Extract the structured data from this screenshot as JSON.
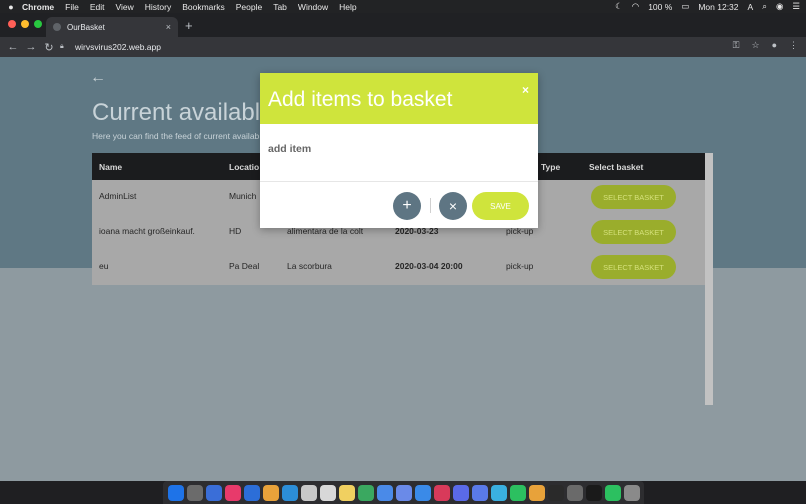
{
  "menubar": {
    "apple": "",
    "items": [
      "Chrome",
      "File",
      "Edit",
      "View",
      "History",
      "Bookmarks",
      "People",
      "Tab",
      "Window",
      "Help"
    ],
    "battery": "100 %",
    "clock": "Mon 12:32"
  },
  "browser": {
    "tab_title": "OurBasket",
    "tab_close": "×",
    "new_tab": "+",
    "url": "wirvsvirus202.web.app",
    "traffic_colors": [
      "#ff5f57",
      "#febc2e",
      "#28c840"
    ]
  },
  "page": {
    "back": "←",
    "title": "Current available b",
    "subtitle": "Here you can find the feed of current availab",
    "table": {
      "headers": {
        "name": "Name",
        "location": "Locatio",
        "type": "Type",
        "select": "Select basket"
      },
      "rows": [
        {
          "name": "AdminList",
          "location": "Munich",
          "place": "",
          "date": "",
          "type": "",
          "button": "SELECT BASKET"
        },
        {
          "name": "ioana macht großeinkauf.",
          "location": "HD",
          "place": "alimentara de la colt",
          "date": "2020-03-23",
          "type": "pick-up",
          "button": "SELECT BASKET"
        },
        {
          "name": "eu",
          "location": "Pa Deal",
          "place": "La scorbura",
          "date": "2020-03-04 20:00",
          "type": "pick-up",
          "button": "SELECT BASKET"
        }
      ]
    }
  },
  "modal": {
    "title": "Add items to basket",
    "close": "×",
    "field_label": "add item",
    "add_button": "+",
    "cancel_button": "×",
    "save_button": "SAVE",
    "accent": "#cfe43c"
  },
  "dock": {
    "icon_colors": [
      "#1e73e8",
      "#6b6b6b",
      "#3a6ed8",
      "#e83a6b",
      "#2c6ed8",
      "#e8a23a",
      "#2c8ed8",
      "#c8c8c8",
      "#d8d8d8",
      "#f0d060",
      "#3aa860",
      "#4a8ae8",
      "#6a8ae8",
      "#3a8ae8",
      "#d83a5a",
      "#5a6ae8",
      "#5a7ae8",
      "#3ab0e0",
      "#2cc060",
      "#e8a23a",
      "#2a2a2a",
      "#6a6a6a",
      "#1a1a1a",
      "#2cc060",
      "#8a8a8a"
    ]
  }
}
